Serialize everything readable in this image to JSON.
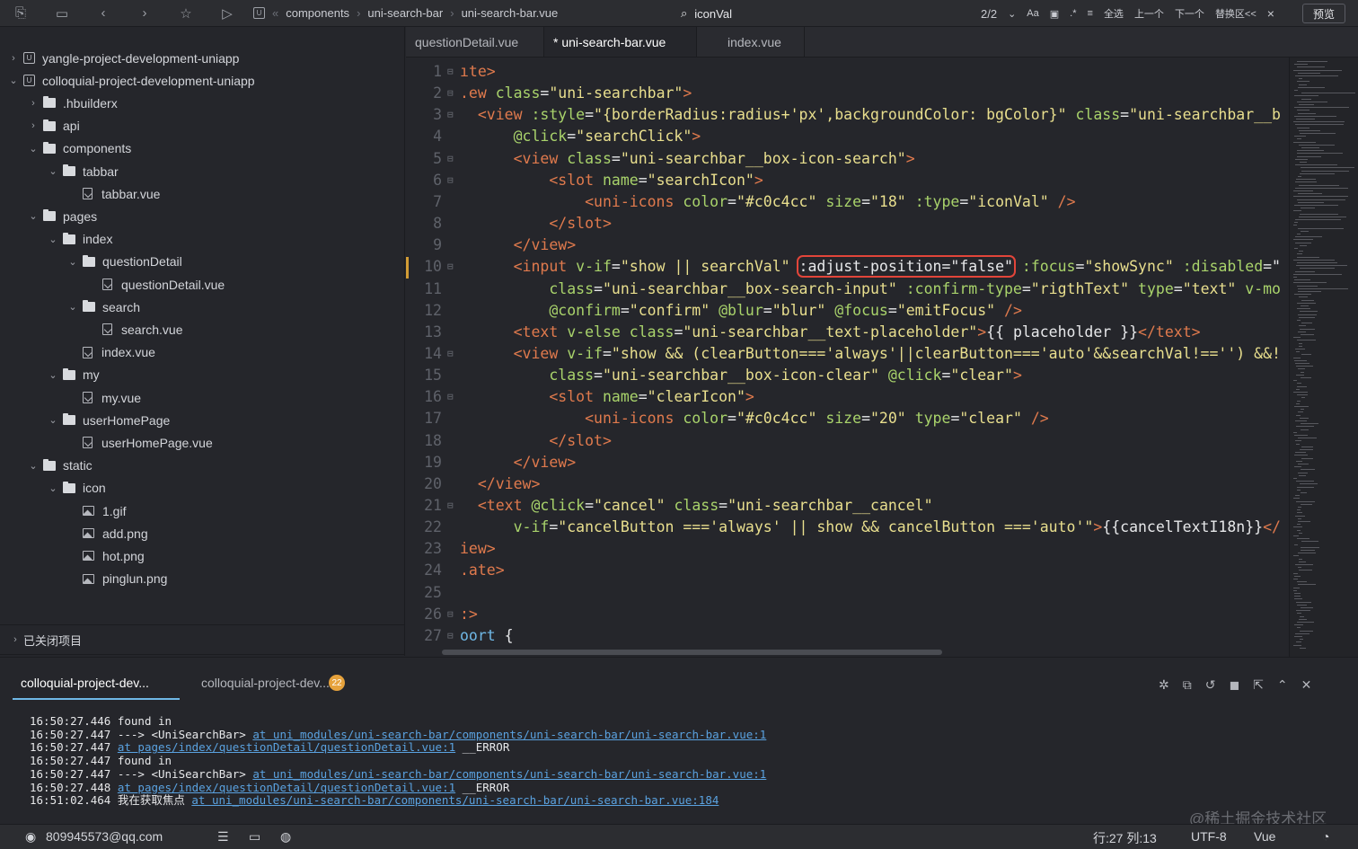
{
  "toolbar": {
    "breadcrumb": [
      "components",
      "uni-search-bar",
      "uni-search-bar.vue"
    ],
    "find_value": "iconVal",
    "match_count": "2/2",
    "case_label": "Aa",
    "select_all": "全选",
    "prev": "上一个",
    "next": "下一个",
    "replace": "替换区<<",
    "close": "×",
    "preview": "预览"
  },
  "tree": [
    {
      "label": "yangle-project-development-uniapp",
      "kind": "project",
      "depth": 0,
      "open": false
    },
    {
      "label": "colloquial-project-development-uniapp",
      "kind": "project",
      "depth": 0,
      "open": true
    },
    {
      "label": ".hbuilderx",
      "kind": "folder",
      "depth": 1,
      "open": false
    },
    {
      "label": "api",
      "kind": "folder",
      "depth": 1,
      "open": false
    },
    {
      "label": "components",
      "kind": "folder",
      "depth": 1,
      "open": true
    },
    {
      "label": "tabbar",
      "kind": "folder",
      "depth": 2,
      "open": true
    },
    {
      "label": "tabbar.vue",
      "kind": "file",
      "depth": 3
    },
    {
      "label": "pages",
      "kind": "folder",
      "depth": 1,
      "open": true
    },
    {
      "label": "index",
      "kind": "folder",
      "depth": 2,
      "open": true
    },
    {
      "label": "questionDetail",
      "kind": "folder",
      "depth": 3,
      "open": true
    },
    {
      "label": "questionDetail.vue",
      "kind": "file",
      "depth": 4
    },
    {
      "label": "search",
      "kind": "folder",
      "depth": 3,
      "open": true
    },
    {
      "label": "search.vue",
      "kind": "file",
      "depth": 4
    },
    {
      "label": "index.vue",
      "kind": "file",
      "depth": 3
    },
    {
      "label": "my",
      "kind": "folder",
      "depth": 2,
      "open": true
    },
    {
      "label": "my.vue",
      "kind": "file",
      "depth": 3
    },
    {
      "label": "userHomePage",
      "kind": "folder",
      "depth": 2,
      "open": true
    },
    {
      "label": "userHomePage.vue",
      "kind": "file",
      "depth": 3
    },
    {
      "label": "static",
      "kind": "folder",
      "depth": 1,
      "open": true
    },
    {
      "label": "icon",
      "kind": "folder",
      "depth": 2,
      "open": true
    },
    {
      "label": "1.gif",
      "kind": "image",
      "depth": 3
    },
    {
      "label": "add.png",
      "kind": "image",
      "depth": 3
    },
    {
      "label": "hot.png",
      "kind": "image",
      "depth": 3
    },
    {
      "label": "pinglun.png",
      "kind": "image",
      "depth": 3
    }
  ],
  "closed_projects": "已关闭项目",
  "side_tools": [
    "git"
  ],
  "tabs": [
    {
      "label": "questionDetail.vue",
      "active": false
    },
    {
      "label": "* uni-search-bar.vue",
      "active": true
    },
    {
      "label": "index.vue",
      "active": false
    }
  ],
  "code": [
    {
      "n": "1",
      "fold": true,
      "parts": [
        [
          "tg",
          "ıte>"
        ]
      ]
    },
    {
      "n": "2",
      "fold": true,
      "parts": [
        [
          "tg",
          ".ew "
        ],
        [
          "at",
          "class"
        ],
        [
          "pl",
          "="
        ],
        [
          "st",
          "\"uni-searchbar\""
        ],
        [
          "tg",
          ">"
        ]
      ]
    },
    {
      "n": "3",
      "fold": true,
      "parts": [
        [
          "pl",
          "  "
        ],
        [
          "tg",
          "<view "
        ],
        [
          "at",
          ":style"
        ],
        [
          "pl",
          "="
        ],
        [
          "st",
          "\"{borderRadius:radius+'px',backgroundColor: bgColor}\""
        ],
        [
          "pl",
          " "
        ],
        [
          "at",
          "class"
        ],
        [
          "pl",
          "="
        ],
        [
          "st",
          "\"uni-searchbar__b"
        ]
      ]
    },
    {
      "n": "4",
      "fold": false,
      "parts": [
        [
          "pl",
          "      "
        ],
        [
          "at",
          "@click"
        ],
        [
          "pl",
          "="
        ],
        [
          "st",
          "\"searchClick\""
        ],
        [
          "tg",
          ">"
        ]
      ]
    },
    {
      "n": "5",
      "fold": true,
      "parts": [
        [
          "pl",
          "      "
        ],
        [
          "tg",
          "<view "
        ],
        [
          "at",
          "class"
        ],
        [
          "pl",
          "="
        ],
        [
          "st",
          "\"uni-searchbar__box-icon-search\""
        ],
        [
          "tg",
          ">"
        ]
      ]
    },
    {
      "n": "6",
      "fold": true,
      "parts": [
        [
          "pl",
          "          "
        ],
        [
          "tg",
          "<slot "
        ],
        [
          "at",
          "name"
        ],
        [
          "pl",
          "="
        ],
        [
          "st",
          "\"searchIcon\""
        ],
        [
          "tg",
          ">"
        ]
      ]
    },
    {
      "n": "7",
      "fold": false,
      "parts": [
        [
          "pl",
          "              "
        ],
        [
          "tg",
          "<uni-icons "
        ],
        [
          "at",
          "color"
        ],
        [
          "pl",
          "="
        ],
        [
          "st",
          "\"#c0c4cc\""
        ],
        [
          "pl",
          " "
        ],
        [
          "at",
          "size"
        ],
        [
          "pl",
          "="
        ],
        [
          "st",
          "\"18\""
        ],
        [
          "pl",
          " "
        ],
        [
          "at",
          ":type"
        ],
        [
          "pl",
          "="
        ],
        [
          "st",
          "\"iconVal\""
        ],
        [
          "pl",
          " "
        ],
        [
          "tg",
          "/>"
        ]
      ]
    },
    {
      "n": "8",
      "fold": false,
      "parts": [
        [
          "pl",
          "          "
        ],
        [
          "tg",
          "</slot>"
        ]
      ]
    },
    {
      "n": "9",
      "fold": false,
      "parts": [
        [
          "pl",
          "      "
        ],
        [
          "tg",
          "</view>"
        ]
      ]
    },
    {
      "n": "10",
      "fold": true,
      "parts": [
        [
          "pl",
          "      "
        ],
        [
          "tg",
          "<input "
        ],
        [
          "at",
          "v-if"
        ],
        [
          "pl",
          "="
        ],
        [
          "st",
          "\"show || searchVal\""
        ],
        [
          "pl",
          " "
        ],
        [
          "hl",
          ":adjust-position=\"false\""
        ],
        [
          "pl",
          " "
        ],
        [
          "at",
          ":focus"
        ],
        [
          "pl",
          "="
        ],
        [
          "st",
          "\"showSync\""
        ],
        [
          "pl",
          " "
        ],
        [
          "at",
          ":disabled"
        ],
        [
          "pl",
          "=\""
        ]
      ]
    },
    {
      "n": "11",
      "fold": false,
      "parts": [
        [
          "pl",
          "          "
        ],
        [
          "at",
          "class"
        ],
        [
          "pl",
          "="
        ],
        [
          "st",
          "\"uni-searchbar__box-search-input\""
        ],
        [
          "pl",
          " "
        ],
        [
          "at",
          ":confirm-type"
        ],
        [
          "pl",
          "="
        ],
        [
          "st",
          "\"rigthText\""
        ],
        [
          "pl",
          " "
        ],
        [
          "at",
          "type"
        ],
        [
          "pl",
          "="
        ],
        [
          "st",
          "\"text\""
        ],
        [
          "pl",
          " "
        ],
        [
          "at",
          "v-mo"
        ]
      ]
    },
    {
      "n": "12",
      "fold": false,
      "parts": [
        [
          "pl",
          "          "
        ],
        [
          "at",
          "@confirm"
        ],
        [
          "pl",
          "="
        ],
        [
          "st",
          "\"confirm\""
        ],
        [
          "pl",
          " "
        ],
        [
          "at",
          "@blur"
        ],
        [
          "pl",
          "="
        ],
        [
          "st",
          "\"blur\""
        ],
        [
          "pl",
          " "
        ],
        [
          "at",
          "@focus"
        ],
        [
          "pl",
          "="
        ],
        [
          "st",
          "\"emitFocus\""
        ],
        [
          "pl",
          " "
        ],
        [
          "tg",
          "/>"
        ]
      ]
    },
    {
      "n": "13",
      "fold": false,
      "parts": [
        [
          "pl",
          "      "
        ],
        [
          "tg",
          "<text "
        ],
        [
          "at",
          "v-else"
        ],
        [
          "pl",
          " "
        ],
        [
          "at",
          "class"
        ],
        [
          "pl",
          "="
        ],
        [
          "st",
          "\"uni-searchbar__text-placeholder\""
        ],
        [
          "tg",
          ">"
        ],
        [
          "pl",
          "{{ placeholder }}"
        ],
        [
          "tg",
          "</text>"
        ]
      ]
    },
    {
      "n": "14",
      "fold": true,
      "parts": [
        [
          "pl",
          "      "
        ],
        [
          "tg",
          "<view "
        ],
        [
          "at",
          "v-if"
        ],
        [
          "pl",
          "="
        ],
        [
          "st",
          "\"show && (clearButton==='always'||clearButton==='auto'&&searchVal!=='') &&!"
        ]
      ]
    },
    {
      "n": "15",
      "fold": false,
      "parts": [
        [
          "pl",
          "          "
        ],
        [
          "at",
          "class"
        ],
        [
          "pl",
          "="
        ],
        [
          "st",
          "\"uni-searchbar__box-icon-clear\""
        ],
        [
          "pl",
          " "
        ],
        [
          "at",
          "@click"
        ],
        [
          "pl",
          "="
        ],
        [
          "st",
          "\"clear\""
        ],
        [
          "tg",
          ">"
        ]
      ]
    },
    {
      "n": "16",
      "fold": true,
      "parts": [
        [
          "pl",
          "          "
        ],
        [
          "tg",
          "<slot "
        ],
        [
          "at",
          "name"
        ],
        [
          "pl",
          "="
        ],
        [
          "st",
          "\"clearIcon\""
        ],
        [
          "tg",
          ">"
        ]
      ]
    },
    {
      "n": "17",
      "fold": false,
      "parts": [
        [
          "pl",
          "              "
        ],
        [
          "tg",
          "<uni-icons "
        ],
        [
          "at",
          "color"
        ],
        [
          "pl",
          "="
        ],
        [
          "st",
          "\"#c0c4cc\""
        ],
        [
          "pl",
          " "
        ],
        [
          "at",
          "size"
        ],
        [
          "pl",
          "="
        ],
        [
          "st",
          "\"20\""
        ],
        [
          "pl",
          " "
        ],
        [
          "at",
          "type"
        ],
        [
          "pl",
          "="
        ],
        [
          "st",
          "\"clear\""
        ],
        [
          "pl",
          " "
        ],
        [
          "tg",
          "/>"
        ]
      ]
    },
    {
      "n": "18",
      "fold": false,
      "parts": [
        [
          "pl",
          "          "
        ],
        [
          "tg",
          "</slot>"
        ]
      ]
    },
    {
      "n": "19",
      "fold": false,
      "parts": [
        [
          "pl",
          "      "
        ],
        [
          "tg",
          "</view>"
        ]
      ]
    },
    {
      "n": "20",
      "fold": false,
      "parts": [
        [
          "pl",
          "  "
        ],
        [
          "tg",
          "</view>"
        ]
      ]
    },
    {
      "n": "21",
      "fold": true,
      "parts": [
        [
          "pl",
          "  "
        ],
        [
          "tg",
          "<text "
        ],
        [
          "at",
          "@click"
        ],
        [
          "pl",
          "="
        ],
        [
          "st",
          "\"cancel\""
        ],
        [
          "pl",
          " "
        ],
        [
          "at",
          "class"
        ],
        [
          "pl",
          "="
        ],
        [
          "st",
          "\"uni-searchbar__cancel\""
        ]
      ]
    },
    {
      "n": "22",
      "fold": false,
      "parts": [
        [
          "pl",
          "      "
        ],
        [
          "at",
          "v-if"
        ],
        [
          "pl",
          "="
        ],
        [
          "st",
          "\"cancelButton ==='always' || show && cancelButton ==='auto'\""
        ],
        [
          "tg",
          ">"
        ],
        [
          "pl",
          "{{cancelTextI18n}}"
        ],
        [
          "tg",
          "</"
        ]
      ]
    },
    {
      "n": "23",
      "fold": false,
      "parts": [
        [
          "tg",
          "iew>"
        ]
      ]
    },
    {
      "n": "24",
      "fold": false,
      "parts": [
        [
          "tg",
          ".ate>"
        ]
      ]
    },
    {
      "n": "25",
      "fold": false,
      "parts": [
        [
          "pl",
          ""
        ]
      ]
    },
    {
      "n": "26",
      "fold": true,
      "parts": [
        [
          "tg",
          ":>"
        ]
      ]
    },
    {
      "n": "27",
      "fold": true,
      "parts": [
        [
          "kw",
          "oort "
        ],
        [
          "pl",
          "{"
        ]
      ]
    }
  ],
  "console": {
    "tabs": [
      "colloquial-project-dev...",
      "colloquial-project-dev..."
    ],
    "badge": "22",
    "logs": [
      {
        "t": "16:50:27.446",
        "text": "found in",
        "link": "",
        "tail": ""
      },
      {
        "t": "16:50:27.447",
        "text": "---> <UniSearchBar>",
        "link": "at uni_modules/uni-search-bar/components/uni-search-bar/uni-search-bar.vue:1",
        "tail": ""
      },
      {
        "t": "16:50:27.447",
        "text": "",
        "link": "at pages/index/questionDetail/questionDetail.vue:1",
        "tail": " __ERROR"
      },
      {
        "t": "16:50:27.447",
        "text": "found in",
        "link": "",
        "tail": ""
      },
      {
        "t": "16:50:27.447",
        "text": "---> <UniSearchBar>",
        "link": "at uni_modules/uni-search-bar/components/uni-search-bar/uni-search-bar.vue:1",
        "tail": ""
      },
      {
        "t": "16:50:27.448",
        "text": "",
        "link": "at pages/index/questionDetail/questionDetail.vue:1",
        "tail": " __ERROR"
      },
      {
        "t": "16:51:02.464",
        "text": "我在获取焦点",
        "link": "at uni_modules/uni-search-bar/components/uni-search-bar/uni-search-bar.vue:184",
        "tail": ""
      }
    ]
  },
  "watermark": "@稀土掘金技术社区",
  "status": {
    "user": "809945573@qq.com",
    "position": "行:27  列:13",
    "encoding": "UTF-8",
    "language": "Vue"
  },
  "colors": {
    "highlight_box": "#e2453a",
    "accent": "#6fb8e6",
    "badge": "#e6a23c",
    "modified_marker": "#d29c35"
  }
}
